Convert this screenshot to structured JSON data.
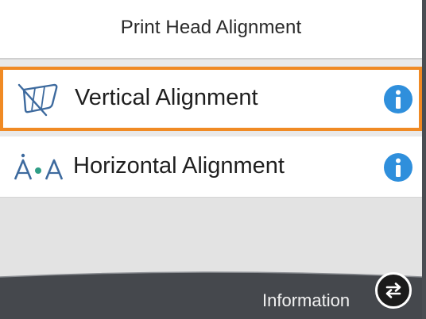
{
  "header": {
    "title": "Print Head Alignment"
  },
  "menu": {
    "items": [
      {
        "label": "Vertical Alignment",
        "icon": "vertical-alignment-icon",
        "selected": true,
        "info_icon": "info-icon"
      },
      {
        "label": "Horizontal Alignment",
        "icon": "horizontal-alignment-icon",
        "selected": false,
        "info_icon": "info-icon"
      }
    ]
  },
  "footer": {
    "info_label": "Information",
    "toggle_icon": "switch-arrows-icon"
  },
  "colors": {
    "highlight": "#f08a24",
    "info_blue": "#2f8fdc",
    "footer_bg": "#45484d"
  }
}
